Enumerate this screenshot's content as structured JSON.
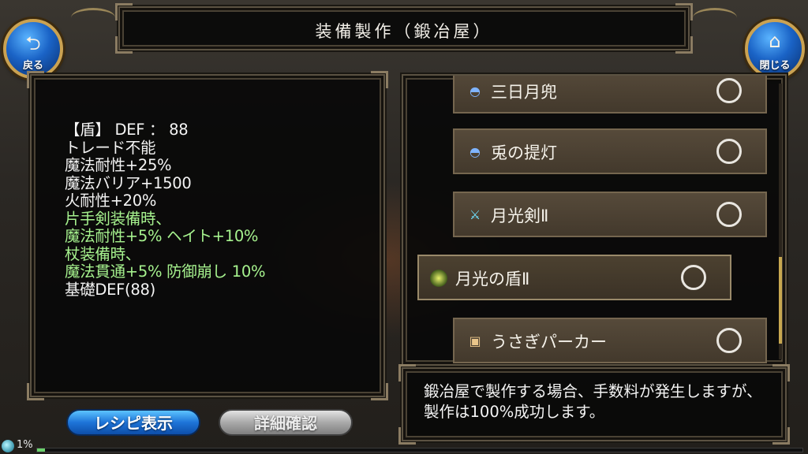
{
  "header": {
    "title": "装備製作（鍛冶屋）",
    "back_label": "戻る",
    "back_icon": "back-arrow-icon",
    "close_label": "閉じる",
    "close_icon": "home-icon"
  },
  "stats": {
    "lines": [
      {
        "text": "【盾】 DEF ： 88",
        "color": "white"
      },
      {
        "text": "トレード不能",
        "color": "white"
      },
      {
        "text": "魔法耐性+25%",
        "color": "white"
      },
      {
        "text": "魔法バリア+1500",
        "color": "white"
      },
      {
        "text": "火耐性+20%",
        "color": "white"
      },
      {
        "text": "片手剣装備時、",
        "color": "green"
      },
      {
        "text": "魔法耐性+5% ヘイト+10%",
        "color": "green"
      },
      {
        "text": "杖装備時、",
        "color": "green"
      },
      {
        "text": "魔法貫通+5% 防御崩し 10%",
        "color": "green"
      },
      {
        "text": "基礎DEF(88)",
        "color": "white"
      }
    ]
  },
  "items": [
    {
      "name": "三日月兜",
      "icon": "helmet-icon",
      "selected": false
    },
    {
      "name": "兎の提灯",
      "icon": "lantern-icon",
      "selected": false
    },
    {
      "name": "月光剣Ⅱ",
      "icon": "sword-icon",
      "selected": false
    },
    {
      "name": "月光の盾Ⅱ",
      "icon": "shield-icon",
      "selected": true
    },
    {
      "name": "うさぎパーカー",
      "icon": "hoodie-icon",
      "selected": false
    }
  ],
  "info": {
    "text": "鍛冶屋で製作する場合、手数料が発生しますが、製作は100%成功します。"
  },
  "buttons": {
    "recipe_label": "レシピ表示",
    "detail_label": "詳細確認"
  },
  "progress": {
    "percent_label": "1%",
    "value": 1
  },
  "colors": {
    "stat_white": "#f4f4f4",
    "stat_green": "#a6f28e",
    "accent_blue": "#1e74d8",
    "frame_gold": "#caa252"
  }
}
